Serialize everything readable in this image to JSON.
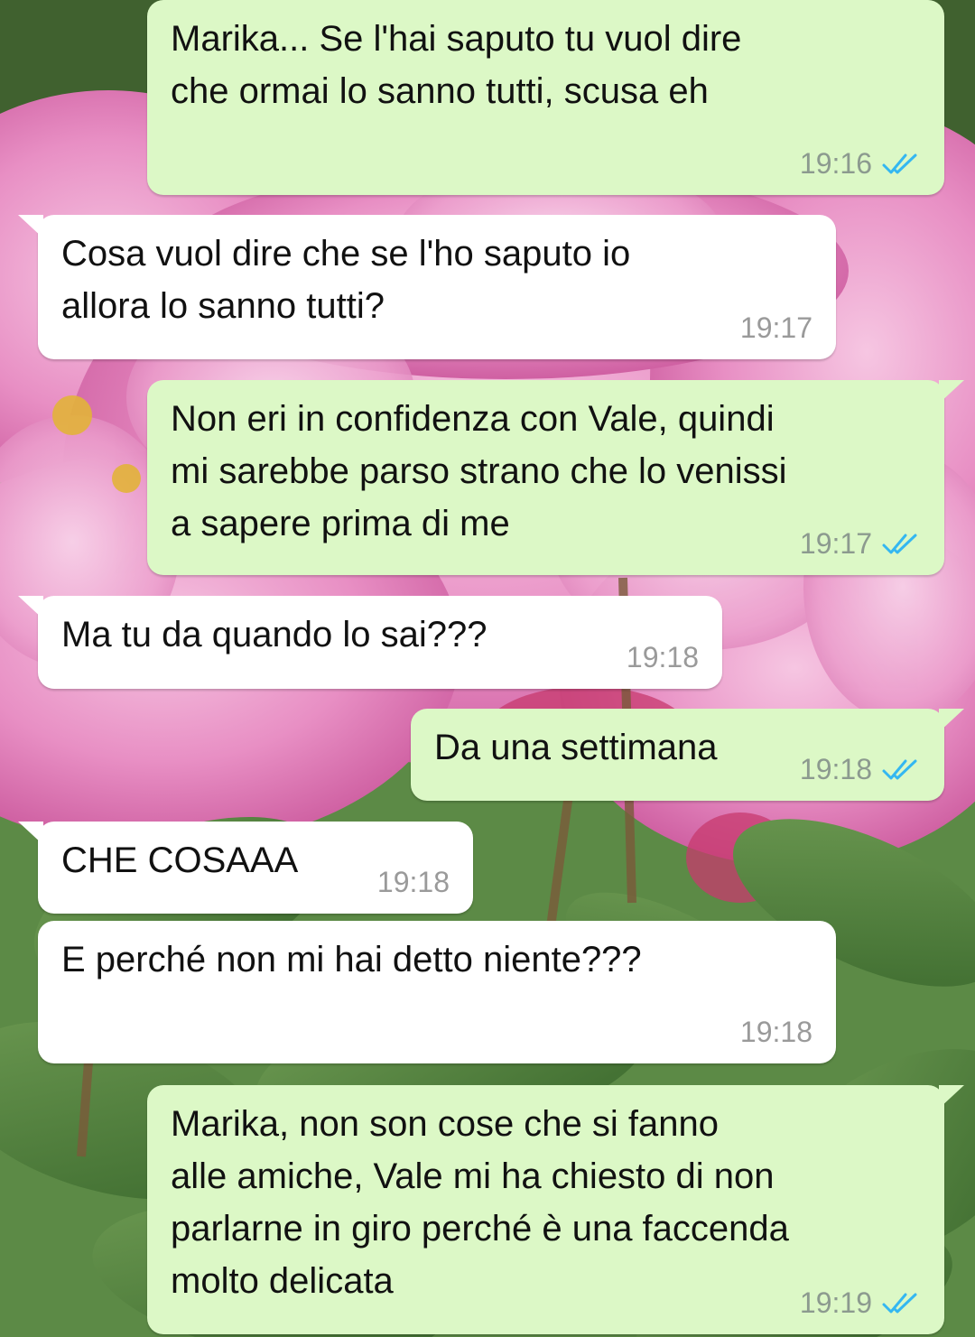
{
  "background": {
    "name": "pink-peony-wallpaper",
    "petal_color": "#e88fc4",
    "leaf_color": "#4c7a3c"
  },
  "colors": {
    "outgoing_bubble": "#dcf8c6",
    "incoming_bubble": "#ffffff",
    "read_ticks": "#34b7f1"
  },
  "messages": [
    {
      "direction": "out",
      "text": "Marika... Se l'hai saputo tu vuol dire\nche ormai lo sanno tutti, scusa eh",
      "time": "19:16",
      "status": "read"
    },
    {
      "direction": "in",
      "text": "Cosa vuol dire che se l'ho saputo io\nallora lo sanno tutti?",
      "time": "19:17"
    },
    {
      "direction": "out",
      "text": "Non eri in confidenza con Vale, quindi\nmi sarebbe parso strano che lo venissi\na sapere prima di me",
      "time": "19:17",
      "status": "read"
    },
    {
      "direction": "in",
      "text": "Ma tu da quando lo sai???",
      "time": "19:18"
    },
    {
      "direction": "out",
      "text": "Da una settimana",
      "time": "19:18",
      "status": "read"
    },
    {
      "direction": "in",
      "text": "CHE COSAAA",
      "time": "19:18"
    },
    {
      "direction": "in",
      "text": "E perché non mi hai detto niente???",
      "time": "19:18"
    },
    {
      "direction": "out",
      "text": "Marika, non son cose che si fanno\nalle amiche, Vale mi ha chiesto di non\nparlarne in giro perché è una faccenda\nmolto delicata",
      "time": "19:19",
      "status": "read"
    }
  ]
}
